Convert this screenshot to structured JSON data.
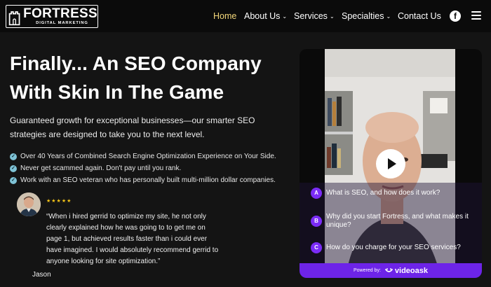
{
  "brand": {
    "name": "FORTRESS",
    "tagline": "DIGITAL MARKETING"
  },
  "nav": {
    "items": [
      {
        "label": "Home",
        "dropdown": false,
        "active": true
      },
      {
        "label": "About Us",
        "dropdown": true,
        "active": false
      },
      {
        "label": "Services",
        "dropdown": true,
        "active": false
      },
      {
        "label": "Specialties",
        "dropdown": true,
        "active": false
      },
      {
        "label": "Contact Us",
        "dropdown": false,
        "active": false
      }
    ],
    "active_color": "#f3d77a",
    "social_icon": "facebook-icon",
    "caret": "⌄"
  },
  "hero": {
    "headline": "Finally... An SEO Company With Skin In The Game",
    "subhead": "Guaranteed growth for exceptional businesses—our smarter SEO strategies are designed to take you to the next level.",
    "bullets": [
      "Over 40 Years of Combined Search Engine Optimization Experience on Your Side.",
      "Never get scammed again. Don't pay until you rank.",
      "Work with an SEO veteran who has personally built multi-million dollar companies."
    ],
    "check_glyph": "✓"
  },
  "review": {
    "stars": "★★★★★",
    "rating": 5,
    "quote": "“When i hired gerrid to optimize my site, he not only clearly explained how he was going to to get me on page 1, but achieved results faster than i could ever have imagined. I would absolutely recommend gerrid to anyone looking for site optimization.”",
    "reviewer": "Jason"
  },
  "video_widget": {
    "questions": [
      {
        "letter": "A",
        "text": "What is SEO, and how does it work?"
      },
      {
        "letter": "B",
        "text": "Why did you start Fortress, and what makes it unique?"
      },
      {
        "letter": "C",
        "text": "How do you charge for your SEO services?"
      }
    ],
    "powered_by": "Powered by:",
    "powered_brand": "videoask",
    "accent": "#7b2cf6"
  }
}
